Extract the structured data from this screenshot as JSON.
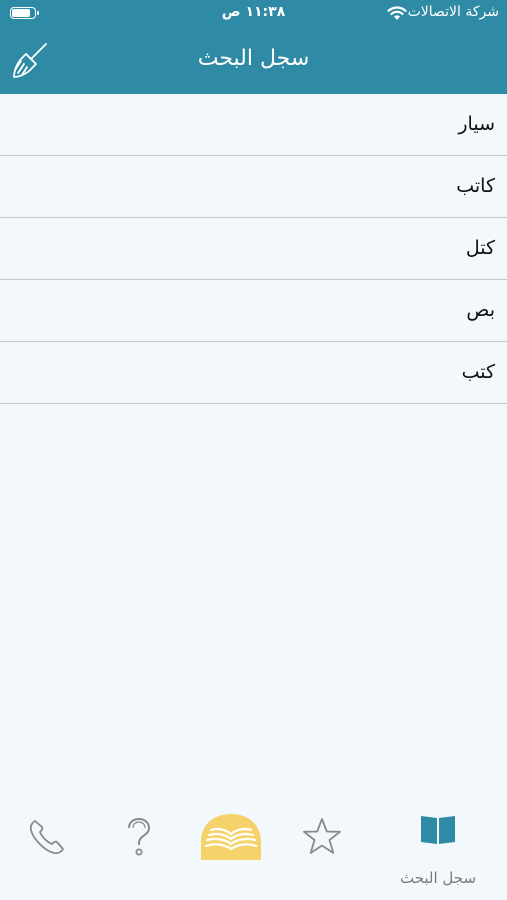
{
  "status_bar": {
    "carrier": "شركة الاتصالات",
    "time": "١١:٣٨ ص",
    "battery_level": 0.85
  },
  "nav_bar": {
    "title": "سجل البحث",
    "clear_icon": "broom-icon"
  },
  "history": {
    "items": [
      {
        "word": "سيار"
      },
      {
        "word": "كاتب"
      },
      {
        "word": "كتل"
      },
      {
        "word": "بص"
      },
      {
        "word": "كتب"
      }
    ]
  },
  "tab_bar": {
    "tabs": [
      {
        "icon": "phone-icon"
      },
      {
        "icon": "question-mark-icon"
      },
      {
        "icon": "quran-book-icon"
      },
      {
        "icon": "star-icon"
      },
      {
        "icon": "open-book-icon",
        "label": "سجل البحث",
        "selected": true
      }
    ],
    "accent_color": "#2e8aa5",
    "center_color": "#f6d36a"
  }
}
